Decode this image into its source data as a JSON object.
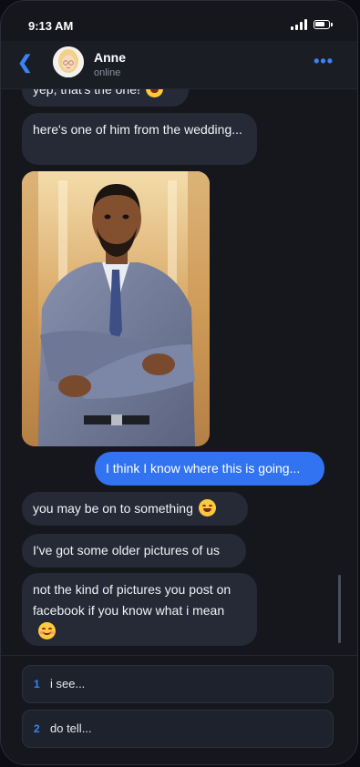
{
  "status_bar": {
    "time": "9:13 AM"
  },
  "header": {
    "back_icon": "chevron-left-icon",
    "contact_name": "Anne",
    "presence": "online",
    "more_icon": "more-dots-icon"
  },
  "messages": [
    {
      "direction": "incoming",
      "text": "yep, that's the one!",
      "emoji": "smiling-face-emoji"
    },
    {
      "direction": "incoming",
      "text": "here's one of him from the wedding..."
    },
    {
      "direction": "incoming",
      "type": "image",
      "alt": "photo"
    },
    {
      "direction": "outgoing",
      "text": "I think I know where this is going..."
    },
    {
      "direction": "incoming",
      "text": "you may be on to something",
      "emoji": "grinning-squinting-face-emoji"
    },
    {
      "direction": "incoming",
      "text": "I've got some older pictures of us"
    },
    {
      "direction": "incoming",
      "text": "not the kind of pictures you post on facebook if you know what i mean",
      "emoji": "smiling-face-with-smiling-eyes-emoji"
    }
  ],
  "replies": [
    {
      "number": "1",
      "label": "i see..."
    },
    {
      "number": "2",
      "label": "do tell..."
    }
  ],
  "colors": {
    "accent": "#3b82f6",
    "outgoing_bubble": "#3173f0",
    "incoming_bubble": "#252a36",
    "background": "#15171d"
  }
}
